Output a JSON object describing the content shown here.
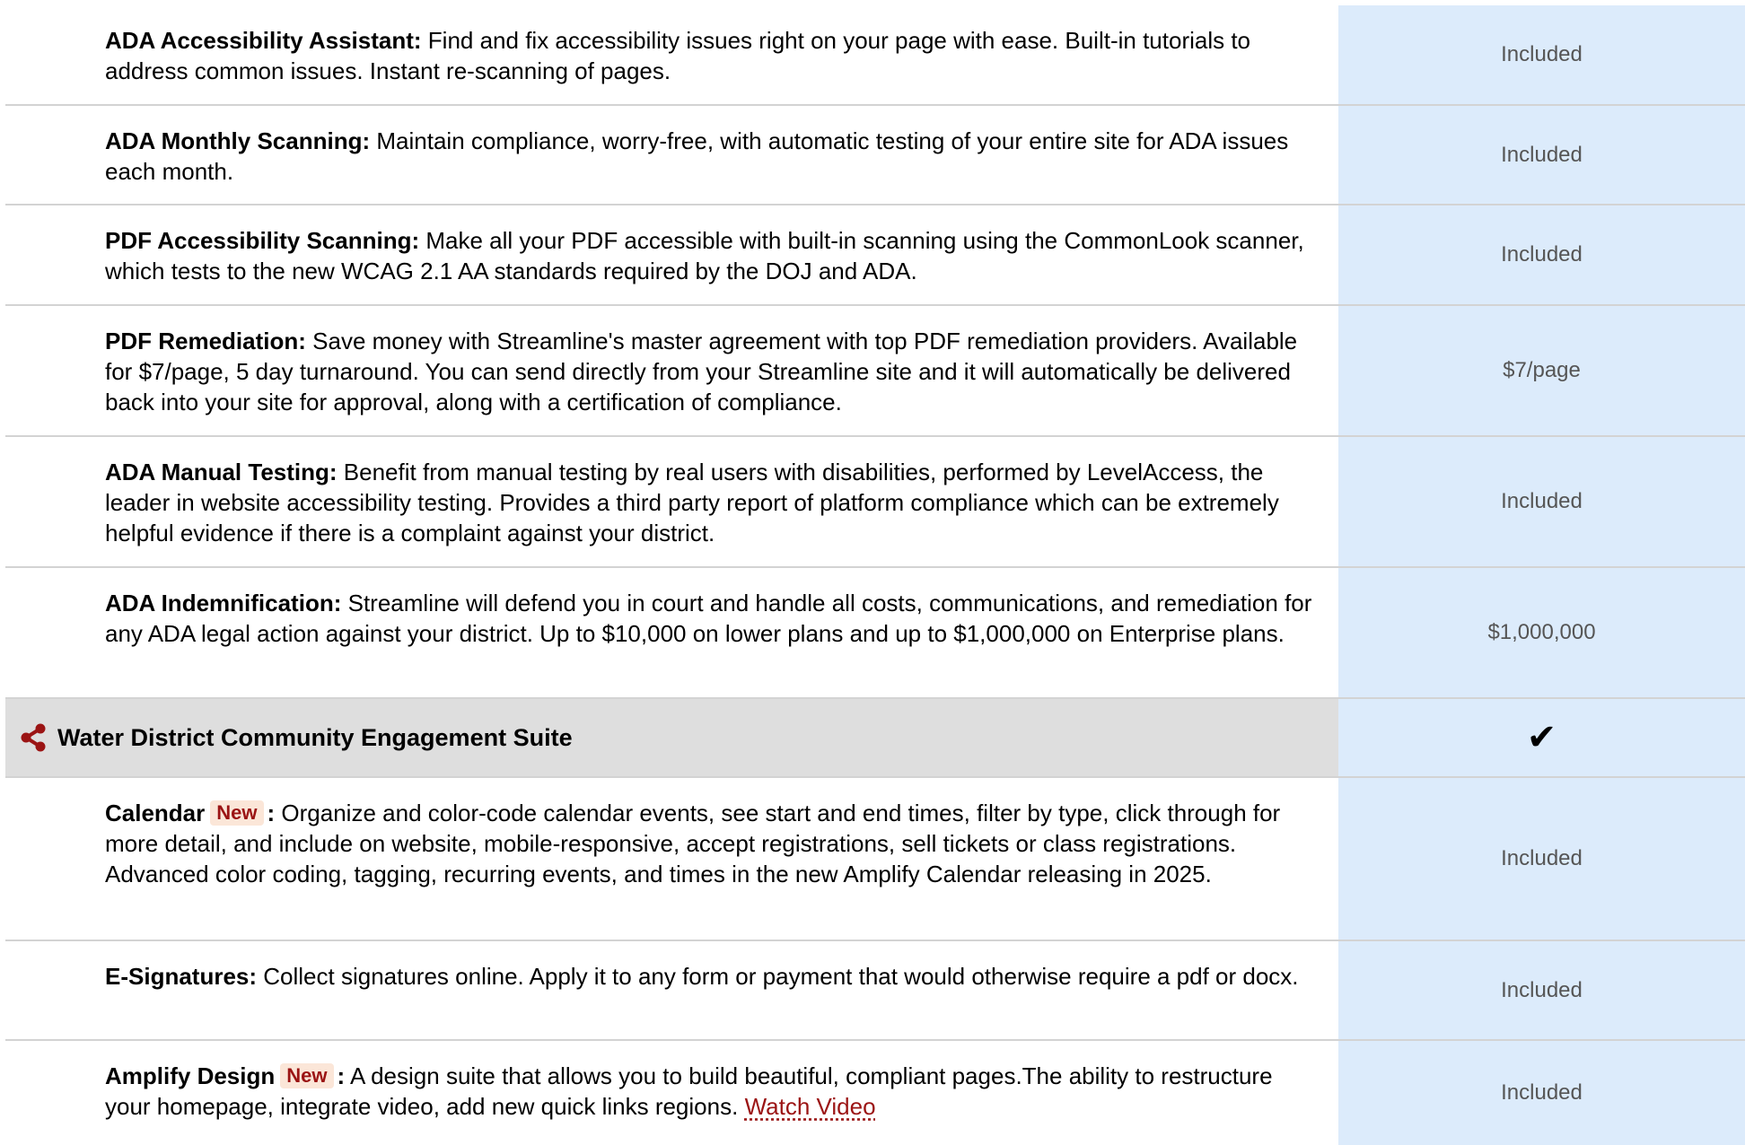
{
  "rows": [
    {
      "title": "ADA Accessibility Assistant:",
      "text": "Find and fix accessibility issues right on your page with ease. Built-in tutorials to address common issues. Instant re-scanning of pages.",
      "value": "Included"
    },
    {
      "title": "ADA Monthly Scanning:",
      "text": "Maintain compliance, worry-free, with automatic testing of your entire site for ADA issues each month.",
      "value": "Included"
    },
    {
      "title": "PDF Accessibility Scanning:",
      "text": "Make all your PDF accessible with built-in scanning using the CommonLook scanner, which tests to the new WCAG 2.1 AA standards required by the DOJ and ADA.",
      "value": "Included"
    },
    {
      "title": "PDF Remediation:",
      "text": "Save money with Streamline's master agreement with top PDF remediation providers. Available for $7/page, 5 day turnaround. You can send directly from your Streamline site and it will automatically be delivered back into your site for approval, along with a certification of compliance.",
      "value": "$7/page"
    },
    {
      "title": "ADA Manual Testing:",
      "text": "Benefit from manual testing by real users with disabilities, performed by LevelAccess, the leader in website accessibility testing. Provides a third party report of platform compliance which can be extremely helpful evidence if there is a complaint against your district.",
      "value": "Included"
    },
    {
      "title": "ADA Indemnification:",
      "text": "Streamline will defend you in court and handle all costs, communications, and remediation for any ADA legal action against your district. Up to $10,000 on lower plans and up to $1,000,000 on Enterprise plans.",
      "value": "$1,000,000"
    }
  ],
  "section": {
    "title": "Water District Community Engagement Suite",
    "value": "✔",
    "icon": "share-icon"
  },
  "rows2": [
    {
      "title": "Calendar",
      "badge": "New",
      "colon": ":",
      "text": "Organize and color-code calendar events, see start and end times, filter by type, click through for more detail, and include on website, mobile-responsive, accept registrations, sell tickets or class registrations. Advanced color coding, tagging, recurring events, and times in the new Amplify Calendar releasing in 2025.",
      "value": "Included"
    },
    {
      "title": "E-Signatures:",
      "text": "Collect signatures online. Apply it to any form or payment that would otherwise require a pdf or docx.",
      "value": "Included"
    },
    {
      "title": "Amplify Design",
      "badge": "New",
      "colon": ":",
      "text": "A design suite that allows you to build beautiful, compliant pages.The ability to restructure your homepage, integrate video, add new quick links regions.",
      "link": "Watch Video",
      "value": "Included"
    }
  ]
}
